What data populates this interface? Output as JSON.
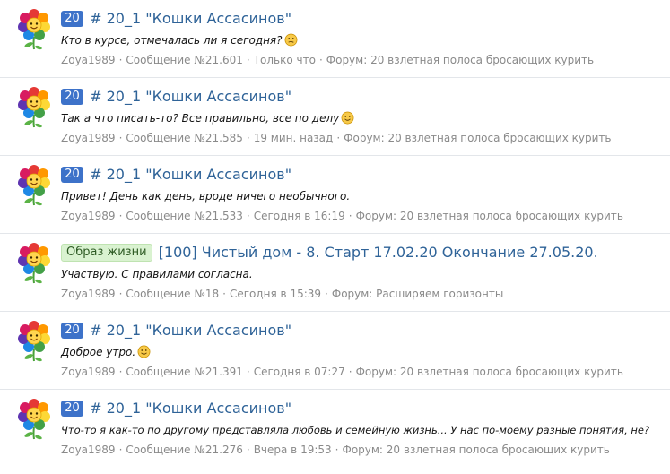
{
  "posts": [
    {
      "badge": "20",
      "badge_style": "number",
      "title": "# 20_1 \"Кошки Ассасинов\"",
      "snippet": "Кто в курсе, отмечалась ли я сегодня?",
      "emoji": "confused-smiley-icon",
      "author": "Zoya1989",
      "message": "Сообщение №21.601",
      "time": "Только что",
      "forum": "Форум: 20 взлетная полоса бросающих курить"
    },
    {
      "badge": "20",
      "badge_style": "number",
      "title": "# 20_1 \"Кошки Ассасинов\"",
      "snippet": "Так а что писать-то? Все правильно, все по делу",
      "emoji": "smiley-icon",
      "author": "Zoya1989",
      "message": "Сообщение №21.585",
      "time": "19 мин. назад",
      "forum": "Форум: 20 взлетная полоса бросающих курить"
    },
    {
      "badge": "20",
      "badge_style": "number",
      "title": "# 20_1 \"Кошки Ассасинов\"",
      "snippet": "Привет! День как день, вроде ничего необычного.",
      "emoji": "",
      "author": "Zoya1989",
      "message": "Сообщение №21.533",
      "time": "Сегодня в 16:19",
      "forum": "Форум: 20 взлетная полоса бросающих курить"
    },
    {
      "badge": "Образ жизни",
      "badge_style": "label",
      "title": "[100] Чистый дом - 8. Старт 17.02.20 Окончание 27.05.20.",
      "snippet": "Участвую. С правилами согласна.",
      "emoji": "",
      "author": "Zoya1989",
      "message": "Сообщение №18",
      "time": "Сегодня в 15:39",
      "forum": "Форум: Расширяем горизонты"
    },
    {
      "badge": "20",
      "badge_style": "number",
      "title": "# 20_1 \"Кошки Ассасинов\"",
      "snippet": "Доброе утро.",
      "emoji": "smiley-icon",
      "author": "Zoya1989",
      "message": "Сообщение №21.391",
      "time": "Сегодня в 07:27",
      "forum": "Форум: 20 взлетная полоса бросающих курить"
    },
    {
      "badge": "20",
      "badge_style": "number",
      "title": "# 20_1 \"Кошки Ассасинов\"",
      "snippet": "Что-то я как-то по другому представляла любовь и семейную жизнь... У нас по-моему разные понятия, не?",
      "emoji": "",
      "author": "Zoya1989",
      "message": "Сообщение №21.276",
      "time": "Вчера в 19:53",
      "forum": "Форум: 20 взлетная полоса бросающих курить"
    }
  ],
  "colors": {
    "link": "#2f6398",
    "badge_number_bg": "#3d72c9",
    "badge_label_bg": "#d9f2d0",
    "meta_text": "#8a8a8a",
    "divider": "#e3e6ea"
  }
}
